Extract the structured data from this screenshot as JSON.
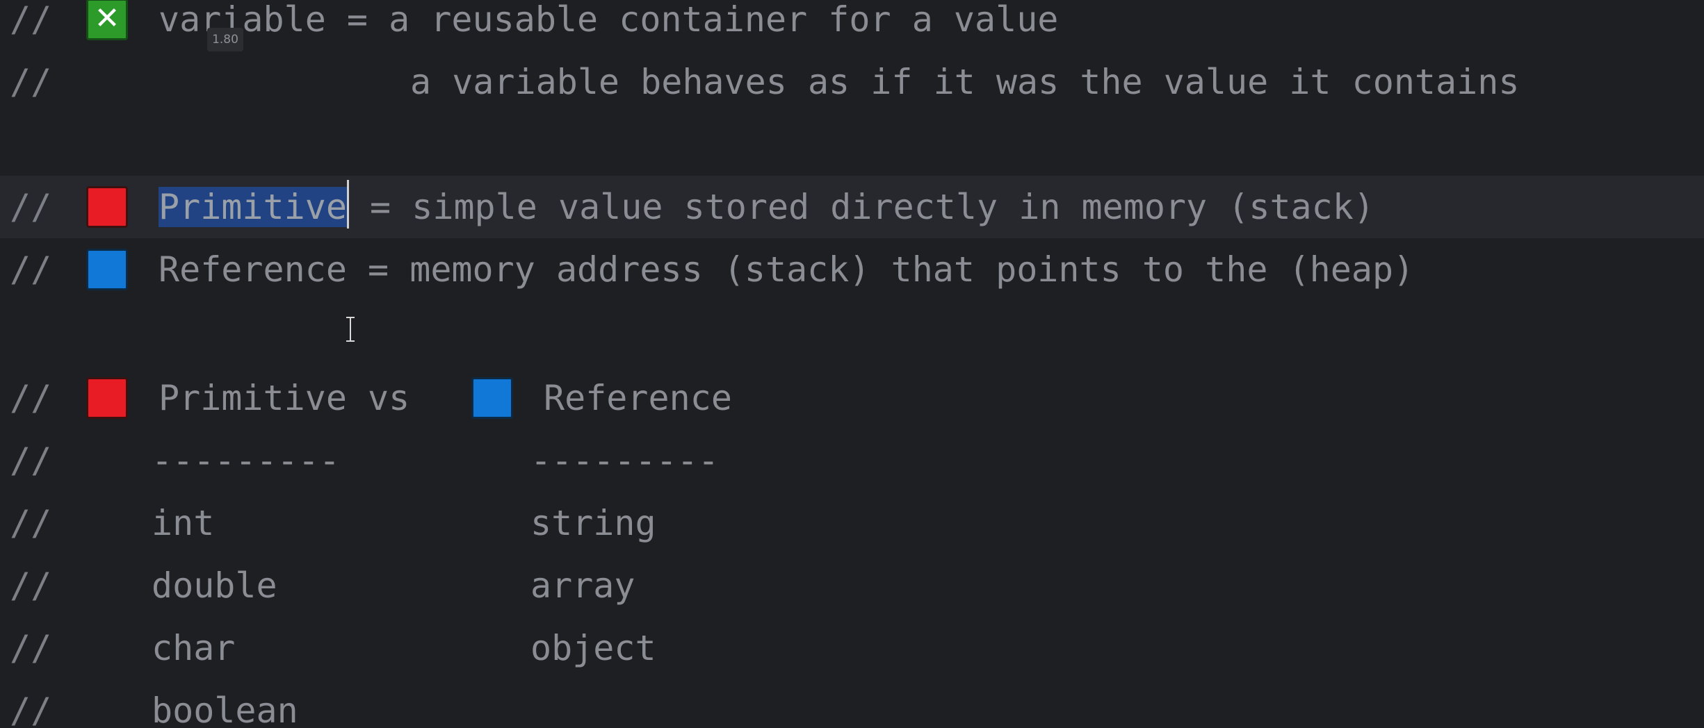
{
  "editor": {
    "comment_prefix": "//",
    "tooltip_value": "1.80",
    "lines": [
      {
        "icon": "cross-mark-icon",
        "text": "variable = a reusable container for a value"
      },
      {
        "text": "a variable behaves as if it was the value it contains"
      },
      {
        "icon": "red-square-icon",
        "selected_text": "Primitive",
        "text": " = simple value stored directly in memory (stack)"
      },
      {
        "icon": "blue-square-icon",
        "text": "Reference = memory address (stack) that points to the (heap)"
      },
      {
        "icon": "red-square-icon",
        "text": "Primitive vs",
        "icon2": "blue-square-icon",
        "text2": "Reference"
      },
      {
        "col1": "---------",
        "col2": "---------"
      },
      {
        "col1": "int",
        "col2": "string"
      },
      {
        "col1": "double",
        "col2": "array"
      },
      {
        "col1": "char",
        "col2": "object"
      },
      {
        "col1": "boolean"
      }
    ]
  },
  "colors": {
    "background": "#1e1f22",
    "current_line": "#26282e",
    "selection": "#214283",
    "comment_text": "#8a8d93",
    "red_square": "#e81c24",
    "blue_square": "#1178d8",
    "green_box": "#2d9b2a"
  }
}
